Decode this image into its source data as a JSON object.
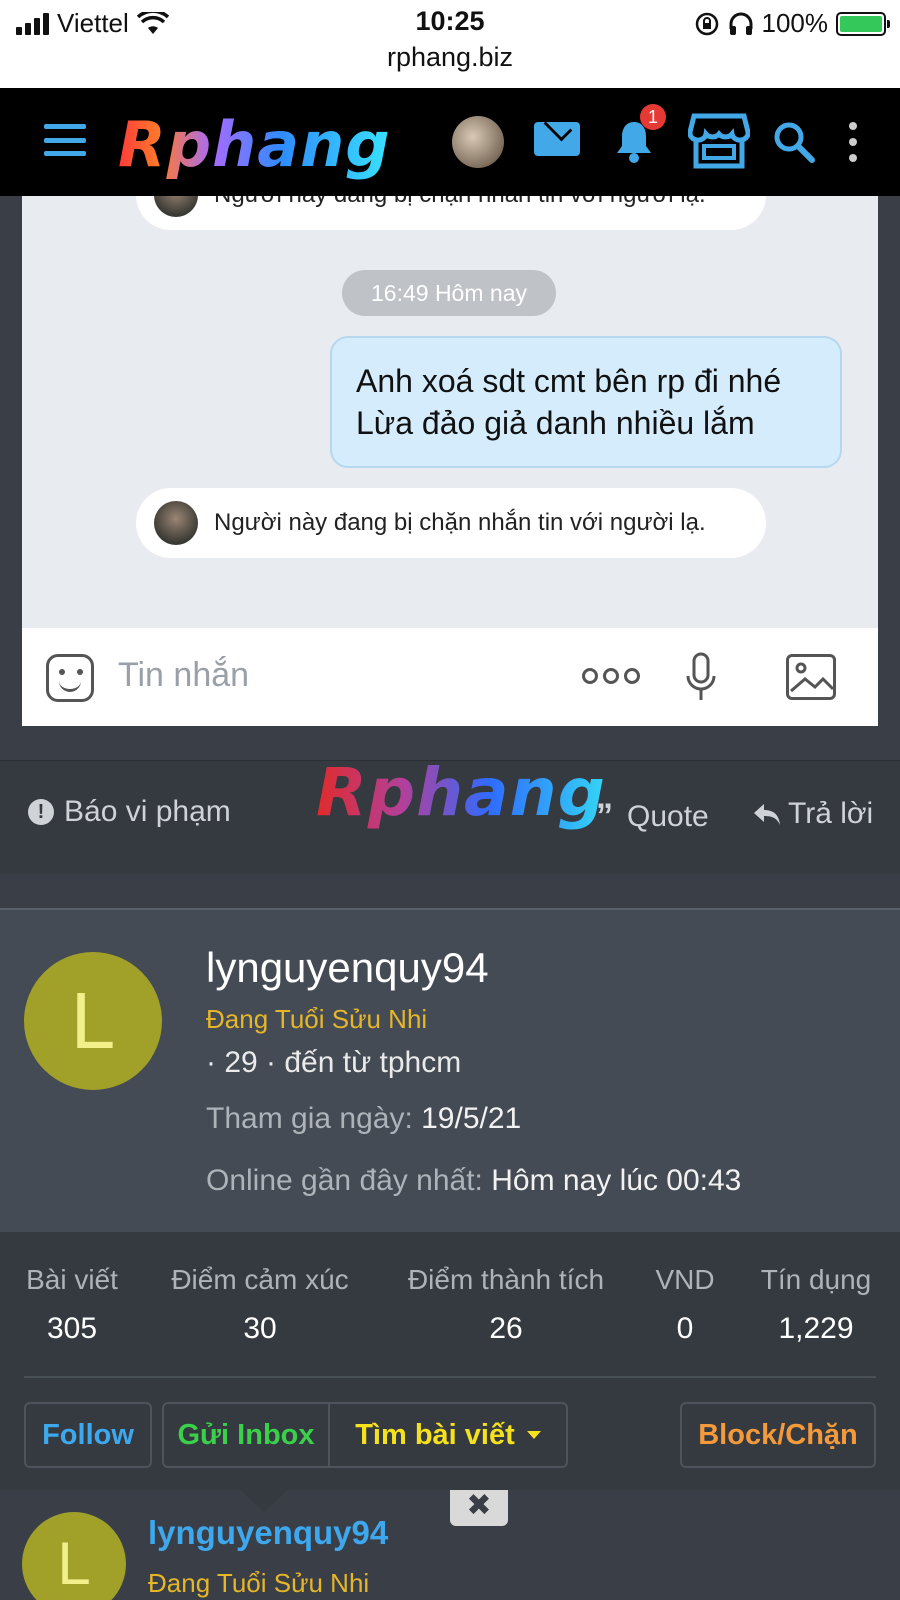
{
  "status_bar": {
    "carrier": "Viettel",
    "time": "10:25",
    "url": "rphang.biz",
    "battery": "100%"
  },
  "header": {
    "logo": "Rphang",
    "notification_count": "1",
    "accent_color": "#43a8e8"
  },
  "chat": {
    "blocked_notice": "Người này đang bị chặn nhắn tin với người lạ.",
    "timestamp": "16:49 Hôm nay",
    "message_line1": "Anh xoá sdt cmt bên rp đi nhé",
    "message_line2": "Lừa đảo giả danh nhiều lắm",
    "input_placeholder": "Tin nhắn"
  },
  "post_actions": {
    "report": "Báo vi phạm",
    "logo": "Rphang",
    "quote": "Quote",
    "reply": "Trả lời"
  },
  "profile": {
    "avatar_letter": "L",
    "username": "lynguyenquy94",
    "title": "Đang Tuổi Sửu Nhi",
    "meta": "· 29 · đến từ tphcm",
    "join_label": "Tham gia ngày:",
    "join_value": "19/5/21",
    "seen_label": "Online gần đây nhất:",
    "seen_value": "Hôm nay lúc 00:43",
    "stats": [
      {
        "label": "Bài viết",
        "value": "305"
      },
      {
        "label": "Điểm cảm xúc",
        "value": "30"
      },
      {
        "label": "Điểm thành tích",
        "value": "26"
      },
      {
        "label": "VND",
        "value": "0"
      },
      {
        "label": "Tín dụng",
        "value": "1,229"
      }
    ],
    "buttons": {
      "follow": "Follow",
      "inbox": "Gửi Inbox",
      "find_posts": "Tìm bài viết",
      "block": "Block/Chặn"
    }
  },
  "next_post": {
    "avatar_letter": "L",
    "username": "lynguyenquy94",
    "title": "Đang Tuổi Sửu Nhi"
  }
}
